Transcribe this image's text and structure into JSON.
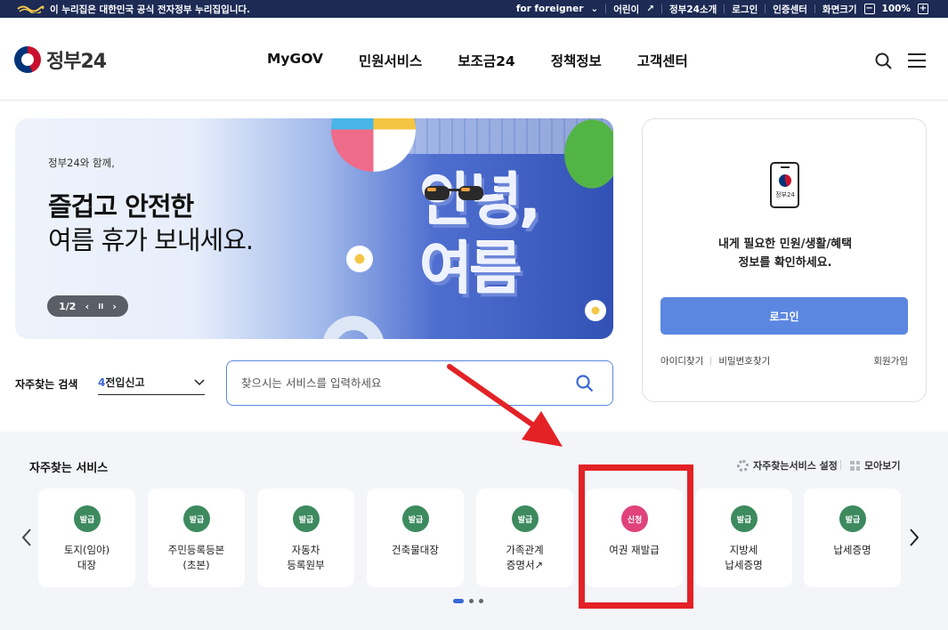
{
  "topbar": {
    "notice": "이 누리집은 대한민국 공식 전자정부 누리집입니다.",
    "foreigner": "for foreigner",
    "kids": "어린이",
    "intro": "정부24소개",
    "login": "로그인",
    "cert": "인증센터",
    "zoom_label": "화면크기",
    "zoom_minus": "−",
    "zoom_value": "100%",
    "zoom_plus": "+"
  },
  "header": {
    "logo_text": "정부24",
    "nav": [
      "MyGOV",
      "민원서비스",
      "보조금24",
      "정책정보",
      "고객센터"
    ]
  },
  "banner": {
    "small": "정부24와 함께,",
    "title1": "즐겁고 안전한",
    "title2": "여름 휴가 보내세요.",
    "pager": "1/2",
    "prev": "‹",
    "pause": "II",
    "next": "›",
    "big_text_line1": "안녕,",
    "big_text_line2": "여름"
  },
  "login_card": {
    "phone_label": "정부24",
    "message_line1": "내게 필요한 민원/생활/혜택",
    "message_line2": "정보를 확인하세요.",
    "login_button": "로그인",
    "find_id": "아이디찾기",
    "find_pw": "비밀번호찾기",
    "join": "회원가입"
  },
  "frequent_search": {
    "label": "자주찾는 검색",
    "selected_num": "4",
    "selected_text": "전입신고"
  },
  "search": {
    "placeholder": "찾으시는 서비스를 입력하세요"
  },
  "services": {
    "heading": "자주찾는 서비스",
    "setting": "자주찾는서비스 설정",
    "view_all": "모아보기",
    "items": [
      {
        "badge": "발급",
        "line1": "토지(임야)",
        "line2": "대장"
      },
      {
        "badge": "발급",
        "line1": "주민등록등본",
        "line2": "(초본)"
      },
      {
        "badge": "발급",
        "line1": "자동차",
        "line2": "등록원부"
      },
      {
        "badge": "발급",
        "line1": "건축물대장",
        "line2": ""
      },
      {
        "badge": "발급",
        "line1": "가족관계",
        "line2": "증명서"
      },
      {
        "badge": "신청",
        "line1": "여권 재발급",
        "line2": ""
      },
      {
        "badge": "발급",
        "line1": "지방세",
        "line2": "납세증명"
      },
      {
        "badge": "발급",
        "line1": "납세증명",
        "line2": ""
      }
    ]
  },
  "colors": {
    "issue_badge": "#3d8a5f",
    "apply_badge": "#e0427a",
    "primary": "#5b87e0",
    "annotation": "#e32226"
  }
}
